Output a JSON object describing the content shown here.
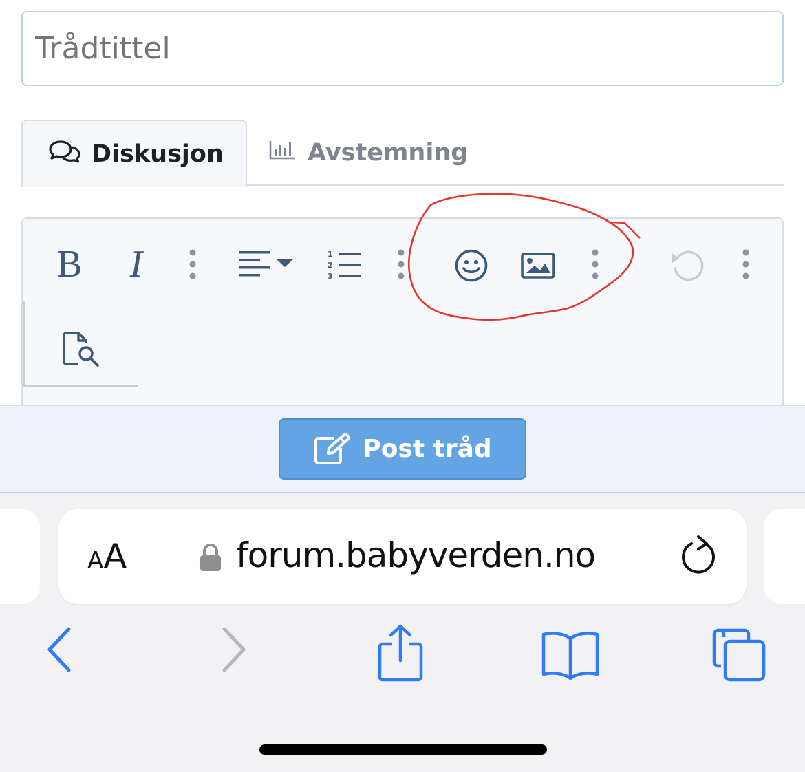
{
  "thread_title": {
    "placeholder": "Trådtittel",
    "value": ""
  },
  "tabs": [
    {
      "label": "Diskusjon",
      "icon": "comments-icon",
      "active": true
    },
    {
      "label": "Avstemning",
      "icon": "bar-chart-icon",
      "active": false
    }
  ],
  "toolbar": {
    "bold_label": "B",
    "italic_label": "I",
    "buttons": [
      "bold",
      "italic",
      "more-text",
      "align",
      "ordered-list",
      "more-paragraph",
      "emoji",
      "insert-image",
      "more-rich",
      "undo",
      "more-misc",
      "preview"
    ]
  },
  "annotation": {
    "type": "hand-drawn circle",
    "color": "#e0382b",
    "encloses": [
      "emoji",
      "insert-image",
      "more-rich"
    ]
  },
  "post_button": {
    "label": "Post tråd",
    "icon": "edit-icon",
    "color": "#63a4e5"
  },
  "browser": {
    "text_size_small": "A",
    "text_size_big": "A",
    "url": "forum.babyverden.no",
    "nav": [
      "back",
      "forward",
      "share",
      "bookmarks",
      "tabs"
    ],
    "accent": "#2f7cf6"
  }
}
